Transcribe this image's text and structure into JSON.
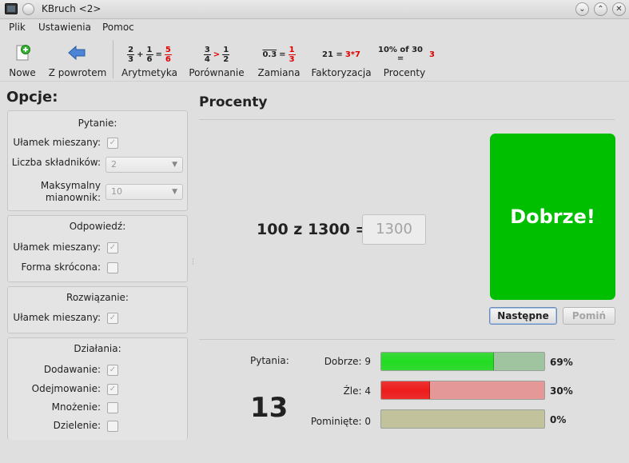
{
  "window": {
    "title": "KBruch <2>",
    "controls": [
      "⌄",
      "⌃",
      "✕"
    ]
  },
  "menu": [
    "Plik",
    "Ustawienia",
    "Pomoc"
  ],
  "toolbar": {
    "new_label": "Nowe",
    "back_label": "Z powrotem",
    "modes": [
      {
        "label": "Arytmetyka"
      },
      {
        "label": "Porównanie"
      },
      {
        "label": "Zamiana"
      },
      {
        "label": "Faktoryzacja"
      },
      {
        "label": "Procenty"
      }
    ],
    "previews": {
      "arithmetic": {
        "a_num": "2",
        "a_den": "3",
        "op": "+",
        "b_num": "1",
        "b_den": "6",
        "eq": "=",
        "r_num": "5",
        "r_den": "6"
      },
      "compare": {
        "a_num": "3",
        "a_den": "4",
        "op": ">",
        "b_num": "1",
        "b_den": "2"
      },
      "convert": {
        "left": "0.3",
        "eq": "=",
        "r_num": "1",
        "r_den": "3"
      },
      "factor": {
        "left": "21 =",
        "right": "3*7"
      },
      "percent": {
        "left": "10% of 30 =",
        "right": "3"
      }
    }
  },
  "options": {
    "title": "Opcje:",
    "question": {
      "title": "Pytanie:",
      "mixed_label": "Ułamek mieszany:",
      "mixed_checked": true,
      "terms_label": "Liczba składników:",
      "terms_value": "2",
      "maxden_label_1": "Maksymalny",
      "maxden_label_2": "mianownik:",
      "maxden_value": "10"
    },
    "answer": {
      "title": "Odpowiedź:",
      "mixed_label": "Ułamek mieszany:",
      "mixed_checked": true,
      "reduced_label": "Forma skrócona:",
      "reduced_checked": false
    },
    "solution": {
      "title": "Rozwiązanie:",
      "mixed_label": "Ułamek mieszany:",
      "mixed_checked": true
    },
    "operations": {
      "title": "Działania:",
      "items": [
        {
          "label": "Dodawanie:",
          "checked": true
        },
        {
          "label": "Odejmowanie:",
          "checked": true
        },
        {
          "label": "Mnożenie:",
          "checked": false
        },
        {
          "label": "Dzielenie:",
          "checked": false
        }
      ]
    }
  },
  "main": {
    "title": "Procenty",
    "task": "100 z 1300 =",
    "answer_value": "1300",
    "result": "Dobrze!",
    "next_label": "Następne",
    "skip_label": "Pomiń"
  },
  "stats": {
    "questions_label": "Pytania:",
    "count": "13",
    "correct_label": "Dobrze: 9",
    "correct_pct": "69%",
    "correct_fraction": 0.69,
    "wrong_label": "Źle: 4",
    "wrong_pct": "30%",
    "wrong_fraction": 0.3,
    "skipped_label": "Pominięte: 0",
    "skipped_pct": "0%",
    "skipped_fraction": 0,
    "colors": {
      "correct_fill": "#22dd22",
      "correct_track": "#9fc49f",
      "wrong_fill": "#ee1c1c",
      "wrong_track": "#e49898",
      "skipped_track": "#c2c29c",
      "result_green": "#00bf00"
    }
  }
}
